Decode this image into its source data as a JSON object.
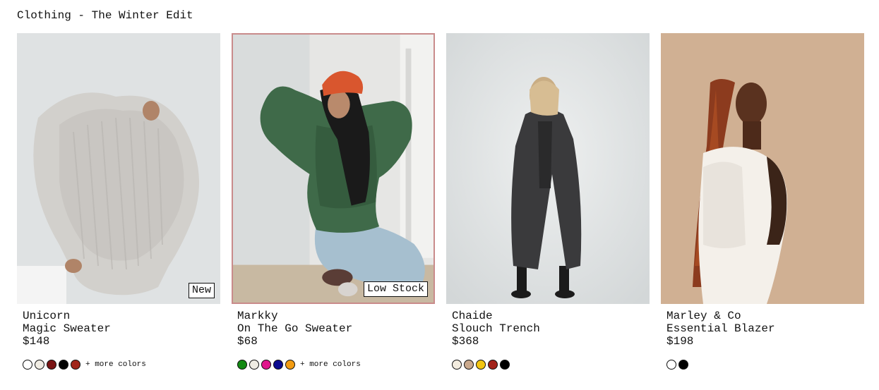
{
  "page": {
    "title": "Clothing - The Winter Edit"
  },
  "products": [
    {
      "brand": "Unicorn",
      "name": "Magic Sweater",
      "price": "$148",
      "badge": "New",
      "colors": [
        "#ffffff",
        "#f1ede4",
        "#7a1414",
        "#000000",
        "#a1261b"
      ],
      "more_colors_label": "+ more colors",
      "image_icon": "model-white-sweater"
    },
    {
      "brand": "Markky",
      "name": "On The Go Sweater",
      "price": "$68",
      "badge": "Low Stock",
      "colors": [
        "#138a13",
        "#efece3",
        "#e0178c",
        "#0b0b8f",
        "#f39c12"
      ],
      "more_colors_label": "+ more colors",
      "image_icon": "model-green-sweater"
    },
    {
      "brand": "Chaide",
      "name": "Slouch Trench",
      "price": "$368",
      "badge": "",
      "colors": [
        "#f3ecdf",
        "#c9a88c",
        "#f2c511",
        "#a3231b",
        "#000000"
      ],
      "more_colors_label": "",
      "image_icon": "model-dark-trench"
    },
    {
      "brand": "Marley & Co",
      "name": "Essential Blazer",
      "price": "$198",
      "badge": "",
      "colors": [
        "#ffffff",
        "#000000"
      ],
      "more_colors_label": "",
      "image_icon": "model-white-blazer"
    }
  ]
}
